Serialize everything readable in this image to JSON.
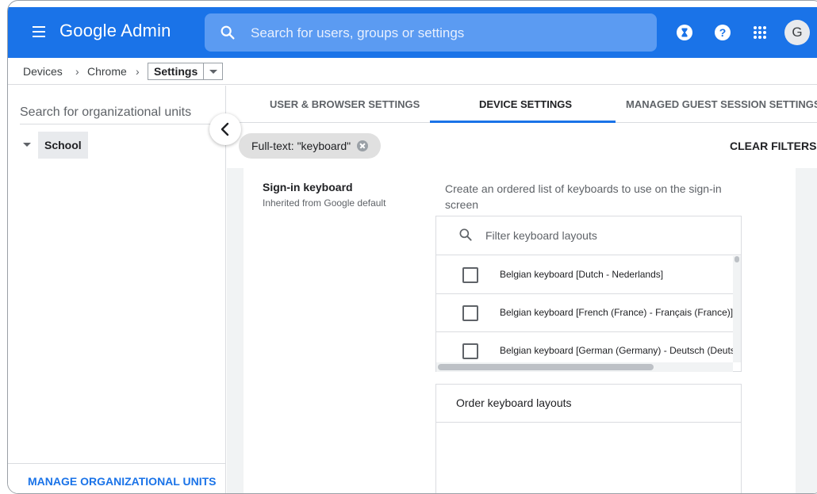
{
  "header": {
    "brand": "Google Admin",
    "search_placeholder": "Search for users, groups or settings",
    "avatar_initial": "G"
  },
  "breadcrumb": {
    "items": [
      "Devices",
      "Chrome"
    ],
    "separator": "›",
    "current": "Settings"
  },
  "sidebar": {
    "search_placeholder": "Search for organizational units",
    "org_units": [
      {
        "label": "School",
        "expanded": true,
        "selected": true
      }
    ],
    "manage_label": "MANAGE ORGANIZATIONAL UNITS"
  },
  "tabs": [
    {
      "label": "USER & BROWSER SETTINGS",
      "active": false
    },
    {
      "label": "DEVICE SETTINGS",
      "active": true
    },
    {
      "label": "MANAGED GUEST SESSION SETTINGS",
      "active": false
    }
  ],
  "filters": {
    "chip_label": "Full-text: \"keyboard\"",
    "clear_label": "CLEAR FILTERS"
  },
  "setting": {
    "title": "Sign-in keyboard",
    "inherited": "Inherited from Google default",
    "description": "Create an ordered list of keyboards to use on the sign-in screen",
    "filter_placeholder": "Filter keyboard layouts",
    "keyboards": [
      {
        "label": "Belgian keyboard [Dutch - Nederlands]",
        "checked": false
      },
      {
        "label": "Belgian keyboard [French (France) - Français (France)]",
        "checked": false
      },
      {
        "label": "Belgian keyboard [German (Germany) - Deutsch (Deutschland)]",
        "checked": false
      }
    ],
    "order_title": "Order keyboard layouts"
  },
  "colors": {
    "brand_blue": "#1a73e8",
    "search_bg": "#5b9bf2",
    "page_bg": "#f1f3f4"
  },
  "icons": {
    "menu": "hamburger-menu-icon",
    "search": "search-icon",
    "hourglass": "hourglass-icon",
    "help": "help-icon",
    "apps": "apps-grid-icon",
    "collapse": "chevron-left-icon",
    "chip_clear": "close-circle-icon",
    "filter": "search-icon"
  }
}
